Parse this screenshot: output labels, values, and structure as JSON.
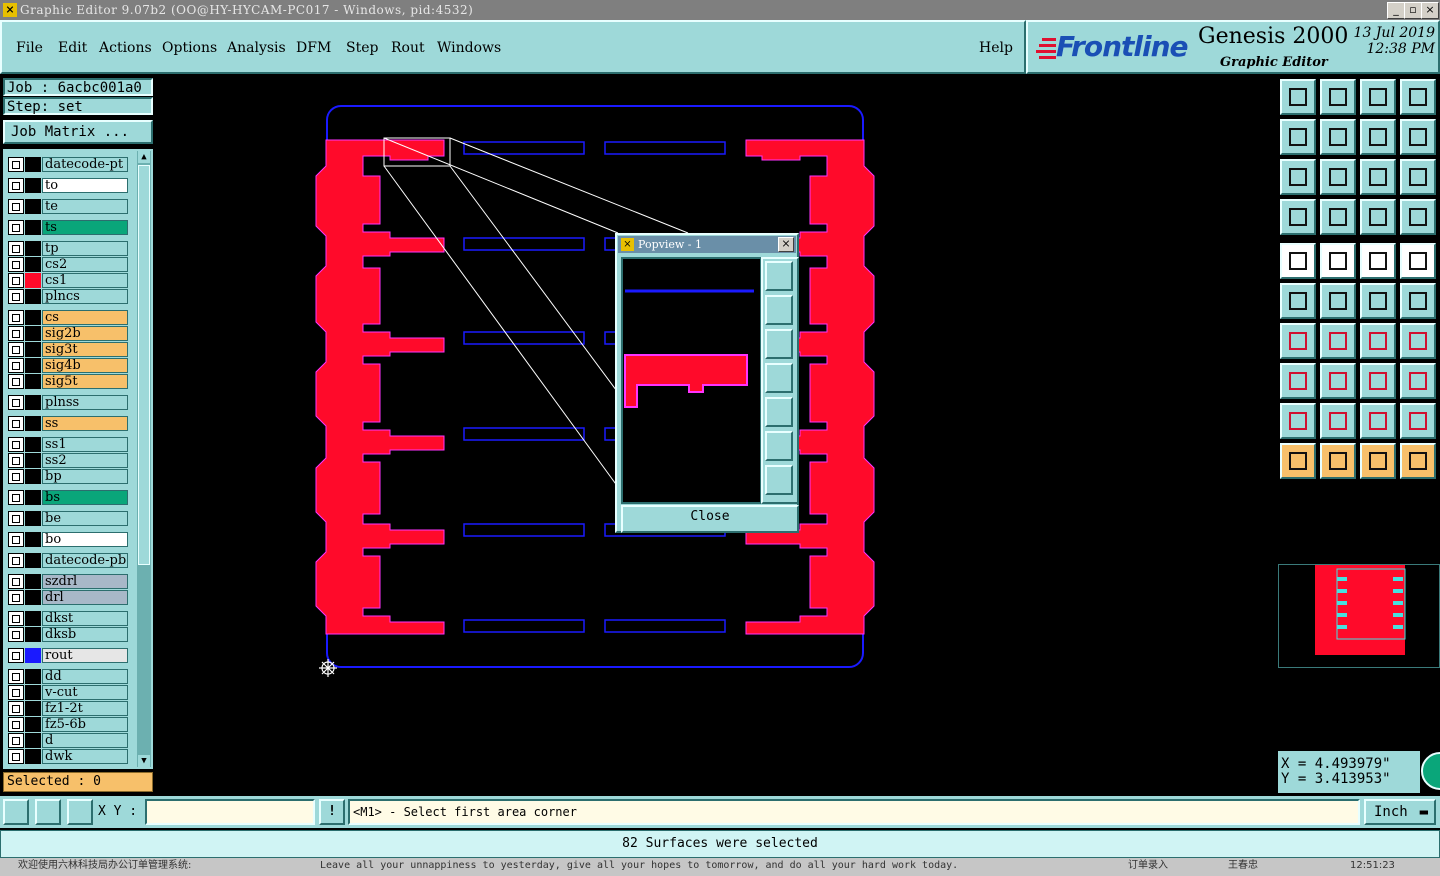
{
  "window": {
    "title": "Graphic Editor 9.07b2 (OO@HY-HYCAM-PC017 - Windows, pid:4532)"
  },
  "menu": {
    "items": [
      "File",
      "Edit",
      "Actions",
      "Options",
      "Analysis",
      "DFM",
      "Step",
      "Rout",
      "Windows"
    ],
    "help": "Help"
  },
  "brand": {
    "logo": "Frontline",
    "product": "Genesis 2000",
    "subtitle": "Graphic Editor",
    "date": "13 Jul 2019",
    "time": "12:38 PM"
  },
  "job": {
    "label": "Job : 6acbc001a0",
    "step": "Step: set",
    "matrix_button": "Job Matrix ..."
  },
  "layers": [
    {
      "name": "datecode-pt",
      "color": "#9ed9d9"
    },
    {
      "name": "to",
      "color": "#ffffff"
    },
    {
      "name": "te",
      "color": "#9ed9d9"
    },
    {
      "name": "ts",
      "color": "#0aa67a"
    },
    {
      "name": "tp",
      "color": "#9ed9d9"
    },
    {
      "name": "cs2",
      "color": "#9ed9d9"
    },
    {
      "name": "cs1",
      "color": "#9ed9d9"
    },
    {
      "name": "plncs",
      "color": "#9ed9d9"
    },
    {
      "name": "cs",
      "color": "#f7c06a"
    },
    {
      "name": "sig2b",
      "color": "#f7c06a"
    },
    {
      "name": "sig3t",
      "color": "#f7c06a"
    },
    {
      "name": "sig4b",
      "color": "#f7c06a"
    },
    {
      "name": "sig5t",
      "color": "#f7c06a"
    },
    {
      "name": "plnss",
      "color": "#9ed9d9"
    },
    {
      "name": "ss",
      "color": "#f7c06a"
    },
    {
      "name": "ss1",
      "color": "#9ed9d9"
    },
    {
      "name": "ss2",
      "color": "#9ed9d9"
    },
    {
      "name": "bp",
      "color": "#9ed9d9"
    },
    {
      "name": "bs",
      "color": "#0aa67a"
    },
    {
      "name": "be",
      "color": "#9ed9d9"
    },
    {
      "name": "bo",
      "color": "#ffffff"
    },
    {
      "name": "datecode-pb",
      "color": "#9ed9d9"
    },
    {
      "name": "szdrl",
      "color": "#a8b8c8"
    },
    {
      "name": "drl",
      "color": "#a8b8c8"
    },
    {
      "name": "dkst",
      "color": "#9ed9d9"
    },
    {
      "name": "dksb",
      "color": "#9ed9d9"
    },
    {
      "name": "rout",
      "color": "#e6e6e6"
    },
    {
      "name": "dd",
      "color": "#9ed9d9"
    },
    {
      "name": "v-cut",
      "color": "#9ed9d9"
    },
    {
      "name": "fz1-2t",
      "color": "#9ed9d9"
    },
    {
      "name": "fz5-6b",
      "color": "#9ed9d9"
    },
    {
      "name": "d",
      "color": "#9ed9d9"
    },
    {
      "name": "dwk",
      "color": "#9ed9d9"
    }
  ],
  "selected": "Selected : 0",
  "popview": {
    "title": "Popview - 1",
    "close": "Close"
  },
  "coords": {
    "x": "X = 4.493979\"",
    "y": "Y = 3.413953\""
  },
  "bottom": {
    "xy_label": "X Y :",
    "xy_value": "",
    "prompt": "<M1> - Select first area corner",
    "units": "Inch"
  },
  "status": "82 Surfaces were selected",
  "taskbar": {
    "left": "欢迎使用六林科技局办公订单管理系统:",
    "motto": "Leave all your unnappiness to yesterday, give all your hopes to tomorrow, and do all your hard work today.",
    "user1": "订单录入",
    "user2": "王春忠",
    "clock": "12:51:23"
  },
  "colors": {
    "panel": "#9ed9d9",
    "accent": "#ff0033",
    "rout": "#1a1aff",
    "highlight": "#ff00ff"
  }
}
